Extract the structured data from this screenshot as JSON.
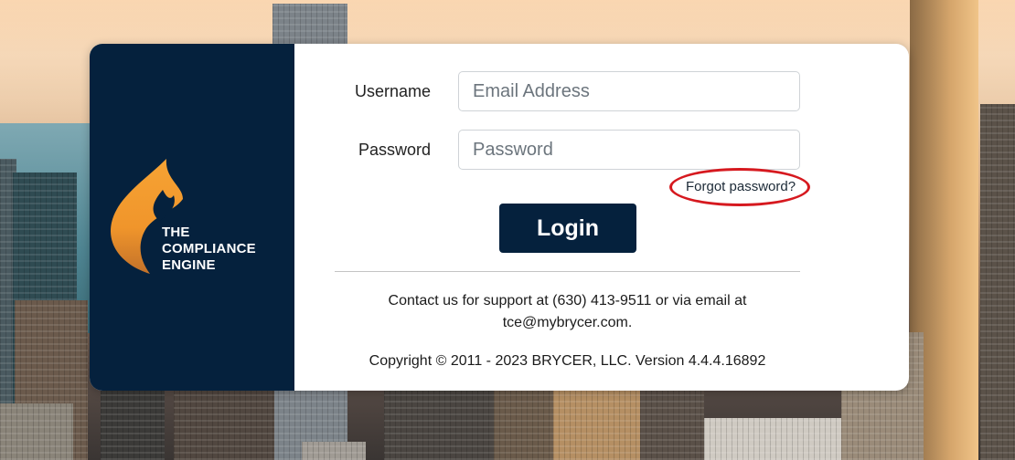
{
  "brand": {
    "logo_icon": "flame-icon",
    "lines": [
      "THE",
      "COMPLIANCE",
      "ENGINE"
    ],
    "panel_color": "#05213d",
    "flame_color": "#f0952b"
  },
  "form": {
    "username": {
      "label": "Username",
      "placeholder": "Email Address",
      "value": ""
    },
    "password": {
      "label": "Password",
      "placeholder": "Password",
      "value": ""
    },
    "forgot_password": "Forgot password?",
    "login_label": "Login",
    "highlight_color": "#d6191f"
  },
  "footer": {
    "contact_line1": "Contact us for support at (630) 413-9511 or via email at",
    "contact_line2": "tce@mybrycer.com.",
    "copyright": "Copyright © 2011 - 2023 BRYCER, LLC. Version 4.4.4.16892"
  }
}
